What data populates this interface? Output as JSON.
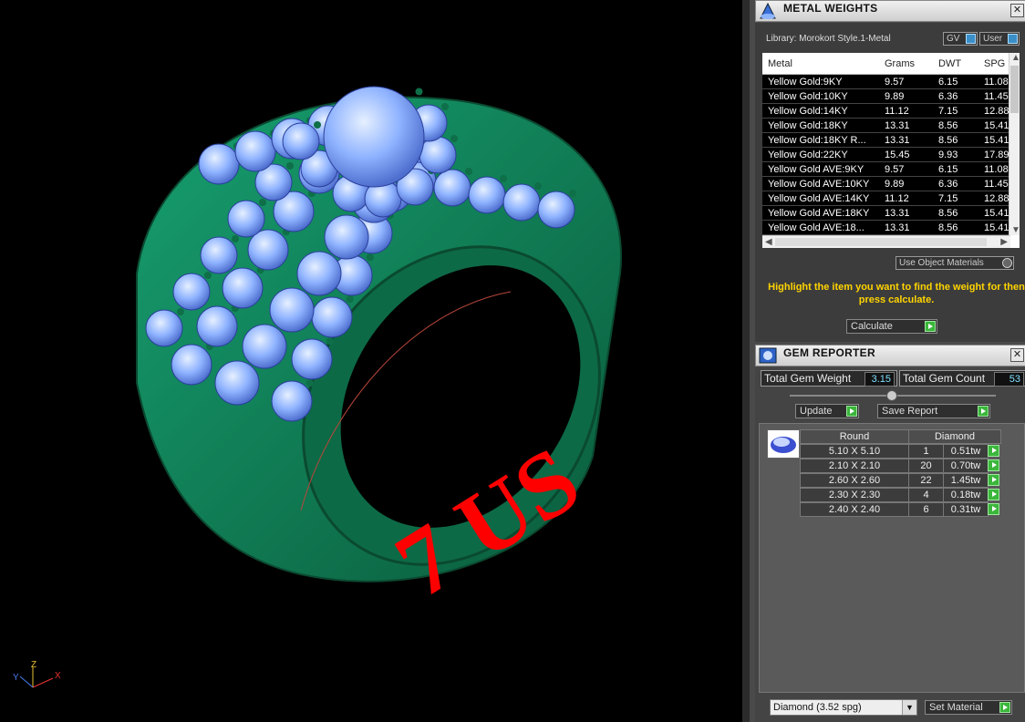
{
  "viewport": {
    "size_label": "7 US",
    "axis": {
      "x": "X",
      "y": "Y",
      "z": "Z"
    },
    "colors": {
      "metal": "#0f7f55",
      "gem": "#7fa8ff",
      "text": "#ff0000"
    }
  },
  "metal_weights": {
    "title": "METAL WEIGHTS",
    "library": "Library: Morokort Style.1-Metal",
    "toggle_gv": "GV",
    "toggle_user": "User",
    "columns": [
      "Metal",
      "Grams",
      "DWT",
      "SPG"
    ],
    "rows": [
      [
        "Yellow Gold:9KY",
        "9.57",
        "6.15",
        "11.08"
      ],
      [
        "Yellow Gold:10KY",
        "9.89",
        "6.36",
        "11.45"
      ],
      [
        "Yellow Gold:14KY",
        "11.12",
        "7.15",
        "12.88"
      ],
      [
        "Yellow Gold:18KY",
        "13.31",
        "8.56",
        "15.41"
      ],
      [
        "Yellow Gold:18KY R...",
        "13.31",
        "8.56",
        "15.41"
      ],
      [
        "Yellow Gold:22KY",
        "15.45",
        "9.93",
        "17.89"
      ],
      [
        "Yellow Gold AVE:9KY",
        "9.57",
        "6.15",
        "11.08"
      ],
      [
        "Yellow Gold AVE:10KY",
        "9.89",
        "6.36",
        "11.45"
      ],
      [
        "Yellow Gold AVE:14KY",
        "11.12",
        "7.15",
        "12.88"
      ],
      [
        "Yellow Gold AVE:18KY",
        "13.31",
        "8.56",
        "15.41"
      ],
      [
        "Yellow Gold AVE:18...",
        "13.31",
        "8.56",
        "15.41"
      ]
    ],
    "use_object_materials": "Use Object Materials",
    "hint": "Highlight the item you want to find the weight for then press calculate.",
    "calculate": "Calculate"
  },
  "gem_reporter": {
    "title": "GEM REPORTER",
    "total_weight_label": "Total Gem Weight",
    "total_weight_value": "3.15",
    "total_count_label": "Total Gem Count",
    "total_count_value": "53",
    "update": "Update",
    "save_report": "Save Report",
    "shape": "Round",
    "material": "Diamond",
    "gems": [
      [
        "5.10 X 5.10",
        "1",
        "0.51tw"
      ],
      [
        "2.10 X 2.10",
        "20",
        "0.70tw"
      ],
      [
        "2.60 X 2.60",
        "22",
        "1.45tw"
      ],
      [
        "2.30 X 2.30",
        "4",
        "0.18tw"
      ],
      [
        "2.40 X 2.40",
        "6",
        "0.31tw"
      ]
    ],
    "material_select": "Diamond    (3.52 spg)",
    "set_material": "Set Material"
  }
}
